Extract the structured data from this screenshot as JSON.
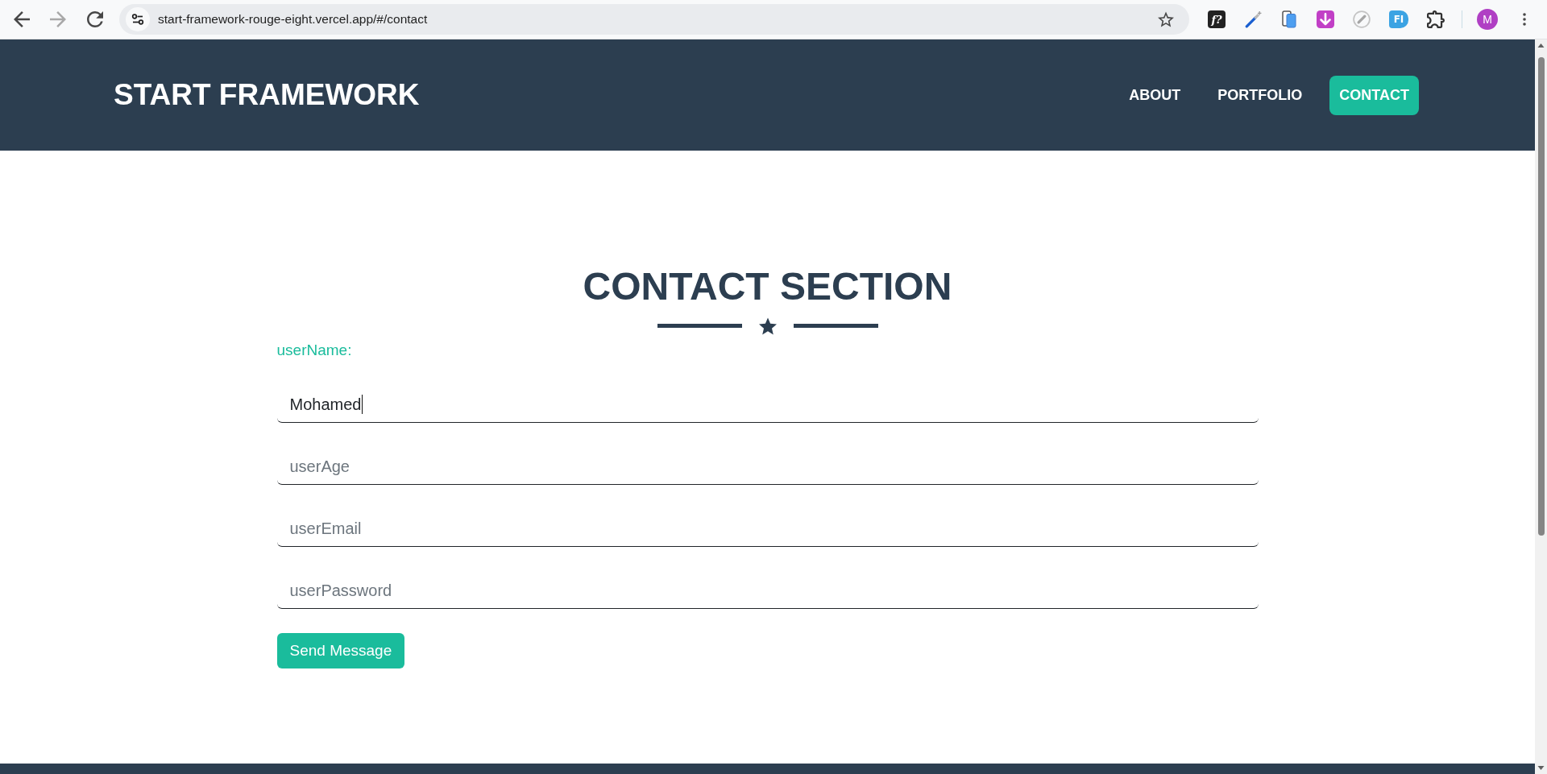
{
  "browser": {
    "back": {
      "disabled": false
    },
    "forward": {
      "disabled": true
    },
    "url": "start-framework-rouge-eight.vercel.app/#/contact",
    "bookmarked": false,
    "extensions": [
      {
        "kind": "tile",
        "label": "f?",
        "color": "#222222"
      },
      {
        "kind": "pen"
      },
      {
        "kind": "phone"
      },
      {
        "kind": "download"
      },
      {
        "kind": "compass"
      },
      {
        "kind": "tag",
        "label": "FI",
        "color": "#3ba3e3"
      },
      {
        "kind": "puzzle"
      }
    ],
    "profile": {
      "initial": "M"
    }
  },
  "navbar": {
    "brand": "START FRAMEWORK",
    "links": [
      {
        "label": "ABOUT",
        "selected": false
      },
      {
        "label": "PORTFOLIO",
        "selected": false
      },
      {
        "label": "CONTACT",
        "selected": true
      }
    ]
  },
  "contact": {
    "title": "CONTACT SECTION",
    "label": "userName:",
    "fields": [
      {
        "value": "Mohamed",
        "focused": true
      },
      {
        "placeholder": "userAge",
        "focused": false
      },
      {
        "placeholder": "userEmail",
        "focused": false
      },
      {
        "placeholder": "userPassword",
        "focused": false
      }
    ],
    "button": "Send Message"
  }
}
